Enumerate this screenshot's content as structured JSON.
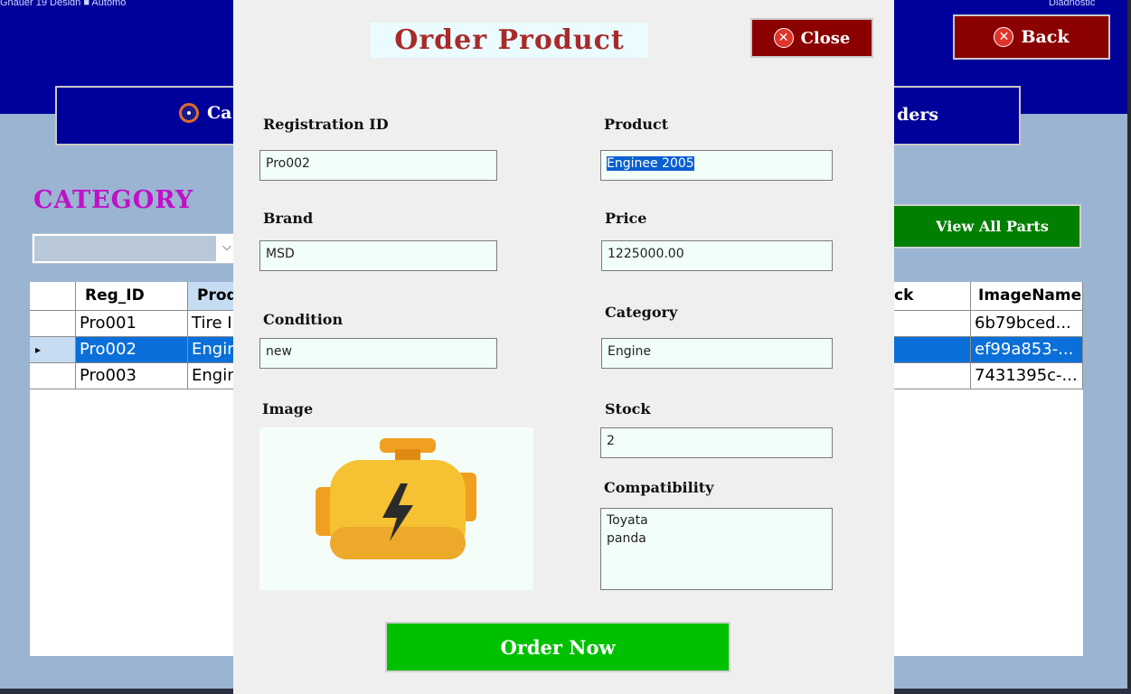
{
  "taskbar": {
    "left_text": "Gnauer   19 Design   ■  Automo",
    "right_text": "Diagnostic"
  },
  "header": {
    "back_label": "Back",
    "nav_category_label": "Ca",
    "nav_orders_label": "ders"
  },
  "main": {
    "category_title": "CATEGORY",
    "category_combo_value": "",
    "view_all_label": "View All Parts",
    "grid": {
      "columns": [
        "",
        "Reg_ID",
        "Prod",
        "ck",
        "ImageName"
      ],
      "rows": [
        {
          "reg_id": "Pro001",
          "product": "Tire I",
          "image_name": "6b79bced..."
        },
        {
          "reg_id": "Pro002",
          "product": "Engin",
          "image_name": "ef99a853-..."
        },
        {
          "reg_id": "Pro003",
          "product": "Engin",
          "image_name": "7431395c-..."
        }
      ],
      "selected_row_marker": "▸"
    }
  },
  "dialog": {
    "title": "Order Product",
    "close_label": "Close",
    "labels": {
      "registration_id": "Registration ID",
      "product": "Product",
      "brand": "Brand",
      "price": "Price",
      "condition": "Condition",
      "category": "Category",
      "image": "Image",
      "stock": "Stock",
      "compatibility": "Compatibility"
    },
    "values": {
      "registration_id": "Pro002",
      "product": "Enginee 2005",
      "brand": "MSD",
      "price": "1225000.00",
      "condition": "new",
      "category": "Engine",
      "stock": "2",
      "compatibility_lines": [
        "Toyata",
        "panda"
      ]
    },
    "image_icon": "engine-icon",
    "order_label": "Order Now"
  },
  "colors": {
    "header_bg": "#00009a",
    "back_bg": "#8b0000",
    "order_btn": "#00c000",
    "view_all_btn": "#007f00",
    "category_title": "#c010c8",
    "dialog_title": "#a82a2a",
    "selected_row": "#0a6fd8"
  }
}
